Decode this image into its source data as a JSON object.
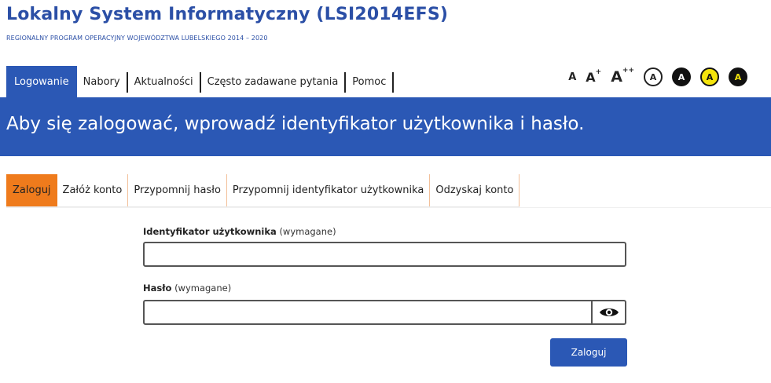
{
  "header": {
    "title": "Lokalny System Informatyczny (LSI2014EFS)",
    "subtitle": "REGIONALNY PROGRAM OPERACYJNY WOJEWÓDZTWA LUBELSKIEGO 2014 – 2020"
  },
  "topnav": {
    "items": [
      {
        "label": "Logowanie"
      },
      {
        "label": "Nabory"
      },
      {
        "label": "Aktualności"
      },
      {
        "label": "Często zadawane pytania"
      },
      {
        "label": "Pomoc"
      }
    ],
    "active_index": 0
  },
  "accessibility": {
    "font_small": "A",
    "font_medium": "A",
    "font_medium_sup": "+",
    "font_large": "A",
    "font_large_sup": "++",
    "contrast_1": "A",
    "contrast_2": "A",
    "contrast_3": "A",
    "contrast_4": "A"
  },
  "banner": {
    "text": "Aby się zalogować, wprowadź identyfikator użytkownika i hasło."
  },
  "tabs": {
    "items": [
      {
        "label": "Zaloguj"
      },
      {
        "label": "Załóż konto"
      },
      {
        "label": "Przypomnij hasło"
      },
      {
        "label": "Przypomnij identyfikator użytkownika"
      },
      {
        "label": "Odzyskaj konto"
      }
    ],
    "active_index": 0
  },
  "form": {
    "user_label": "Identyfikator użytkownika",
    "user_required": "(wymagane)",
    "user_value": "",
    "password_label": "Hasło",
    "password_required": "(wymagane)",
    "password_value": "",
    "submit_label": "Zaloguj"
  },
  "colors": {
    "brand_blue": "#2b58b5",
    "title_blue": "#2b4fa6",
    "active_tab_orange": "#ef7b1c"
  },
  "icons": {
    "password_toggle": "eye-icon"
  }
}
